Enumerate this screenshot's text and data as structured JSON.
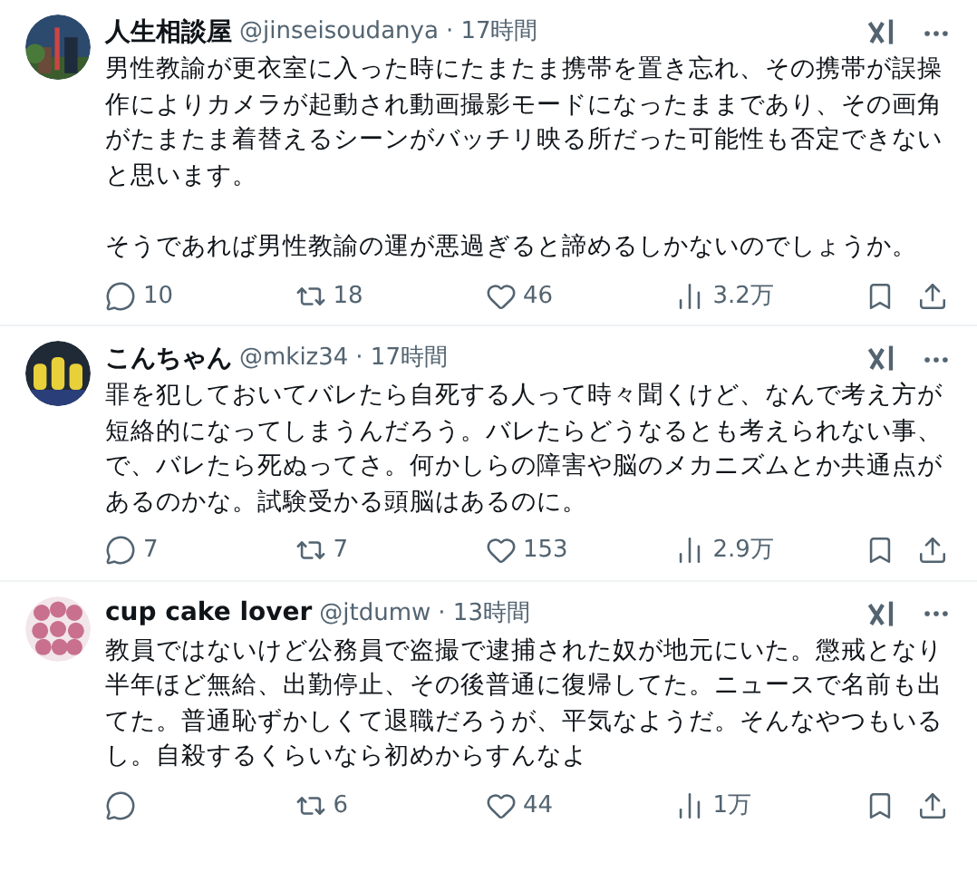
{
  "posts": [
    {
      "avatar": {
        "kind": "picture"
      },
      "name": "人生相談屋",
      "handle": "@jinseisoudanya",
      "time": "· 17時間",
      "paragraphs": [
        "男性教諭が更衣室に入った時にたまたま携帯を置き忘れ、その携帯が誤操作によりカメラが起動され動画撮影モードになったままであり、その画角がたまたま着替えるシーンがバッチリ映る所だった可能性も否定できないと思います。",
        "そうであれば男性教諭の運が悪過ぎると諦めるしかないのでしょうか。"
      ],
      "replies": "10",
      "reposts": "18",
      "likes": "46",
      "views": "3.2万"
    },
    {
      "avatar": {
        "kind": "picture"
      },
      "name": "こんちゃん",
      "handle": "@mkiz34",
      "time": "· 17時間",
      "paragraphs": [
        "罪を犯しておいてバレたら自死する人って時々聞くけど、なんで考え方が短絡的になってしまうんだろう。バレたらどうなるとも考えられない事、で、バレたら死ぬってさ。何かしらの障害や脳のメカニズムとか共通点があるのかな。試験受かる頭脳はあるのに。"
      ],
      "replies": "7",
      "reposts": "7",
      "likes": "153",
      "views": "2.9万"
    },
    {
      "avatar": {
        "kind": "picture"
      },
      "name": "cup cake lover",
      "handle": "@jtdumw",
      "time": "· 13時間",
      "paragraphs": [
        "教員ではないけど公務員で盗撮で逮捕された奴が地元にいた。懲戒となり半年ほど無給、出勤停止、その後普通に復帰してた。ニュースで名前も出てた。普通恥ずかしくて退職だろうが、平気なようだ。そんなやつもいるし。自殺するくらいなら初めからすんなよ"
      ],
      "reposts": "6",
      "likes": "44",
      "views": "1万"
    }
  ]
}
